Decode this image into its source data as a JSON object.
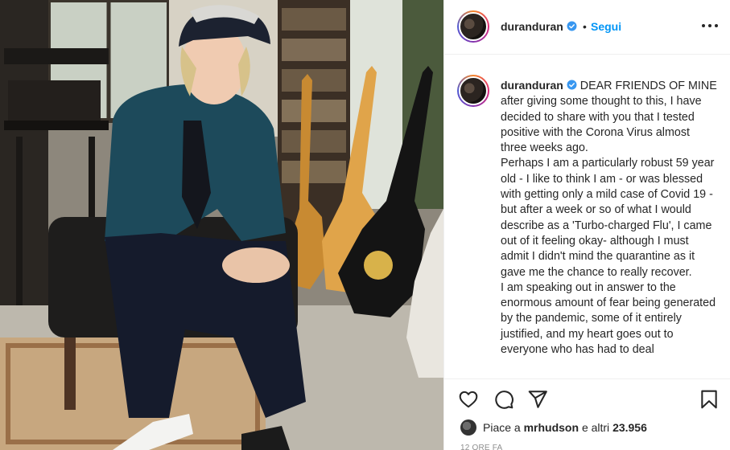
{
  "post": {
    "author": "duranduran",
    "follow_separator": "•",
    "follow_label": "Segui",
    "caption": [
      "DEAR FRIENDS OF MINE after giving some thought to this, I have decided to share with you that I tested positive with the Corona Virus almost three weeks ago.",
      "Perhaps I am a particularly robust 59 year old - I like to think I am - or was blessed with getting only a mild case of Covid 19 - but after a week or so of what I would describe as a 'Turbo-charged Flu', I came out of it feeling okay- although I must admit I didn't mind the quarantine as it gave me the chance to really recover.",
      "I am speaking out in answer to the enormous amount of fear being generated by the pandemic, some of it entirely justified, and my heart goes out to everyone who has had to deal"
    ],
    "likes": {
      "prefix": "Piace a",
      "user": "mrhudson",
      "middle": "e altri",
      "count": "23.956"
    },
    "timestamp": "12 ORE FA"
  },
  "icons": {
    "more": "more-options-icon",
    "verified": "verified-badge-icon",
    "like": "heart-icon",
    "comment": "comment-icon",
    "share": "paper-plane-icon",
    "save": "bookmark-icon"
  },
  "colors": {
    "accent": "#0095f6",
    "text": "#262626",
    "muted": "#8e8e8e",
    "border": "#efefef"
  }
}
